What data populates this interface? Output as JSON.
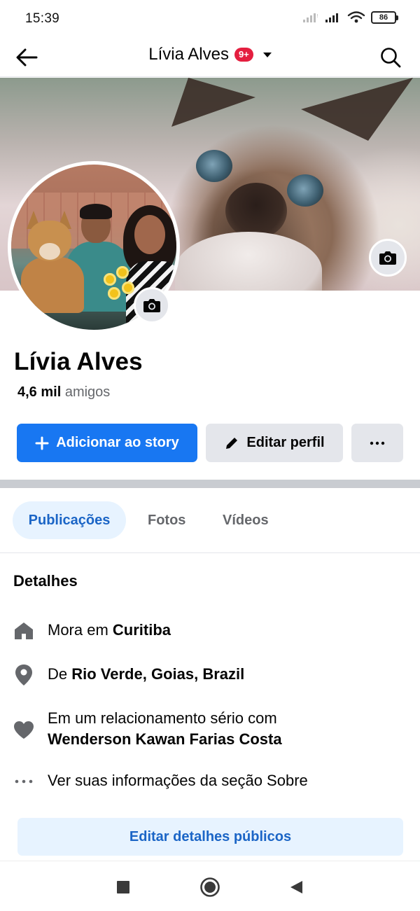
{
  "status_bar": {
    "time": "15:39",
    "battery": "86"
  },
  "header": {
    "title": "Lívia Alves",
    "badge": "9+"
  },
  "profile": {
    "name": "Lívia Alves",
    "friends_count": "4,6 mil",
    "friends_label": "amigos"
  },
  "actions": {
    "add_story": "Adicionar ao story",
    "edit_profile": "Editar perfil",
    "more": "···"
  },
  "tabs": [
    {
      "label": "Publicações",
      "active": true
    },
    {
      "label": "Fotos",
      "active": false
    },
    {
      "label": "Vídeos",
      "active": false
    }
  ],
  "details": {
    "title": "Detalhes",
    "lives_prefix": "Mora em",
    "lives_value": "Curitiba",
    "from_prefix": "De",
    "from_value": "Rio Verde, Goias, Brazil",
    "relationship_prefix": "Em um relacionamento sério com",
    "relationship_value": "Wenderson Kawan Farias Costa",
    "about_link": "Ver suas informações da seção Sobre",
    "edit_button": "Editar detalhes públicos"
  },
  "icons": {
    "back": "arrow-left-icon",
    "search": "search-icon",
    "camera": "camera-icon",
    "home": "house-icon",
    "location": "location-pin-icon",
    "heart": "heart-icon",
    "ellipsis": "ellipsis-icon"
  },
  "colors": {
    "primary": "#1877f2",
    "primary_text": "#1b65c6",
    "tab_active_bg": "#e7f3ff",
    "secondary_button": "#e4e6eb",
    "badge": "#e41e3f",
    "muted_text": "#65676b",
    "icon_gray": "#65676b"
  }
}
